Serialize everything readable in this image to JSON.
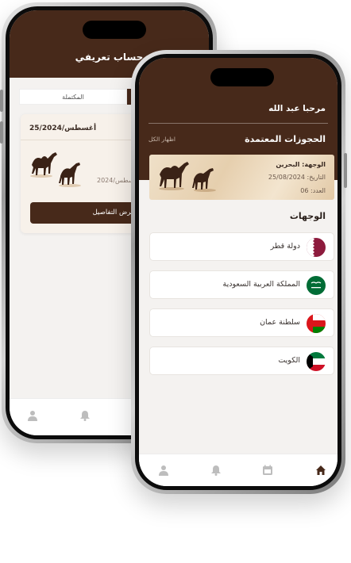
{
  "back_screen": {
    "title": "حساب تعريفي",
    "tab_completed": "المكتملة",
    "card_date": "25/أغسطس/2024",
    "card_date_partial": "سطس/2024",
    "details_button": "عرض التفاصيل"
  },
  "front_screen": {
    "greeting": "مرحبا عبد الله",
    "reservations_title": "الحجوزات المعتمدة",
    "show_all": "اظهار الكل",
    "reservation": {
      "destination": "الوجهة: البحرين",
      "date": "التاريخ: 25/08/2024",
      "count": "العدد: 06"
    },
    "destinations_title": "الوجهات",
    "destinations": [
      {
        "label": "دولة قطر",
        "flag": "qatar-flag-icon"
      },
      {
        "label": "المملكة العربية السعودية",
        "flag": "saudi-flag-icon"
      },
      {
        "label": "سلطنة عمان",
        "flag": "oman-flag-icon"
      },
      {
        "label": "الكويت",
        "flag": "kuwait-flag-icon"
      }
    ],
    "nav": [
      "home-icon",
      "calendar-icon",
      "bell-icon",
      "profile-icon"
    ]
  },
  "colors": {
    "header_brown": "#47291a",
    "qatar_maroon": "#8d1b3d",
    "saudi_green": "#006c35",
    "oman_red": "#db161b",
    "kuwait_green": "#007a3d"
  }
}
